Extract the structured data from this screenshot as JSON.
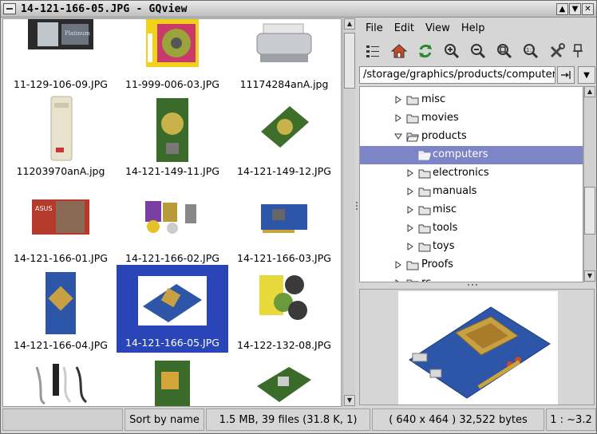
{
  "window": {
    "title": "14-121-166-05.JPG - GQview"
  },
  "thumbnails": [
    {
      "name": "11-129-106-09.JPG",
      "icon": "computer-case-photo"
    },
    {
      "name": "11-999-006-03.JPG",
      "icon": "fan-package-photo"
    },
    {
      "name": "11174284anA.jpg",
      "icon": "printer-photo"
    },
    {
      "name": "11203970anA.jpg",
      "icon": "tower-pc-photo"
    },
    {
      "name": "14-121-149-11.JPG",
      "icon": "graphics-card-photo"
    },
    {
      "name": "14-121-149-12.JPG",
      "icon": "graphics-card-photo"
    },
    {
      "name": "14-121-166-01.JPG",
      "icon": "graphics-card-box-photo"
    },
    {
      "name": "14-121-166-02.JPG",
      "icon": "bundle-contents-photo"
    },
    {
      "name": "14-121-166-03.JPG",
      "icon": "graphics-card-photo"
    },
    {
      "name": "14-121-166-04.JPG",
      "icon": "graphics-card-photo"
    },
    {
      "name": "14-121-166-05.JPG",
      "icon": "graphics-card-photo",
      "selected": true
    },
    {
      "name": "14-122-132-08.JPG",
      "icon": "software-cds-photo"
    },
    {
      "name": "",
      "icon": "cables-photo"
    },
    {
      "name": "",
      "icon": "tv-tuner-card-photo"
    },
    {
      "name": "",
      "icon": "pci-card-photo"
    }
  ],
  "menu": {
    "file": "File",
    "edit": "Edit",
    "view": "View",
    "help": "Help"
  },
  "path": {
    "value": "/storage/graphics/products/computers"
  },
  "tree": [
    {
      "label": "misc",
      "level": 1,
      "expanded": false
    },
    {
      "label": "movies",
      "level": 1,
      "expanded": false
    },
    {
      "label": "products",
      "level": 1,
      "expanded": true
    },
    {
      "label": "computers",
      "level": 2,
      "expanded": null,
      "selected": true
    },
    {
      "label": "electronics",
      "level": 2,
      "expanded": false
    },
    {
      "label": "manuals",
      "level": 2,
      "expanded": false
    },
    {
      "label": "misc",
      "level": 2,
      "expanded": false
    },
    {
      "label": "tools",
      "level": 2,
      "expanded": false
    },
    {
      "label": "toys",
      "level": 2,
      "expanded": false
    },
    {
      "label": "Proofs",
      "level": 1,
      "expanded": false
    },
    {
      "label": "rc",
      "level": 1,
      "expanded": false
    }
  ],
  "status": {
    "sort": "Sort by name",
    "files": "1.5 MB, 39 files (31.8 K, 1)",
    "image": "( 640 x 464 ) 32,522 bytes",
    "zoom": "1 : ~3.2"
  },
  "colors": {
    "selection": "#2a45b8",
    "tree_selection": "#7d85c6"
  }
}
